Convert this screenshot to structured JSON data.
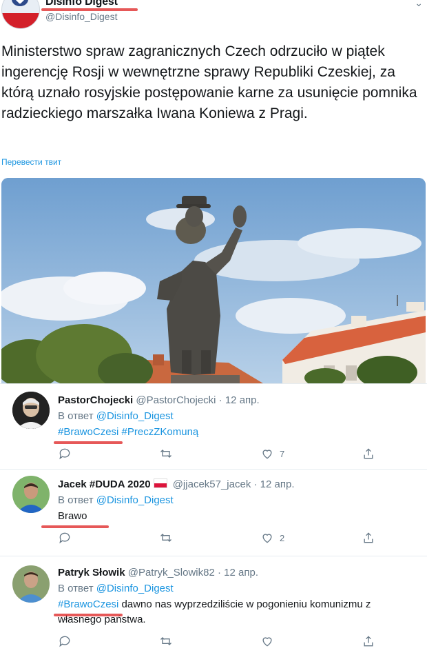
{
  "author": {
    "name": "Disinfo Digest",
    "handle": "@Disinfo_Digest"
  },
  "tweet": {
    "text": "Ministerstwo spraw zagranicznych Czech odrzuciło w piątek ingerencję Rosji w wewnętrzne sprawy Republiki Czeskiej, za którą uznało rosyjskie postępowanie karne za usunięcie pomnika radzieckiego marszałka Iwana Koniewa z Pragi.",
    "translate_label": "Перевести твит"
  },
  "replies": [
    {
      "name": "PastorChojecki",
      "handle": "@PastorChojecki",
      "separator": " · ",
      "date": "12 апр.",
      "reply_prefix": "В ответ ",
      "reply_to": "@Disinfo_Digest",
      "hashtags": [
        "#BrawoCzesi",
        "#PreczZKomuną"
      ],
      "likes": "7"
    },
    {
      "name": "Jacek #DUDA 2020",
      "handle": "@jjacek57_jacek",
      "separator": " · ",
      "date": "12 апр.",
      "reply_prefix": "В ответ ",
      "reply_to": "@Disinfo_Digest",
      "text": "Brawo",
      "likes": "2"
    },
    {
      "name": "Patryk Słowik",
      "handle": "@Patryk_Slowik82",
      "separator": " · ",
      "date": "12 апр.",
      "reply_prefix": "В ответ ",
      "reply_to": "@Disinfo_Digest",
      "hashtag": "#BrawoCzesi",
      "text": " dawno nas wyprzedziliście w pogonieniu komunizmu z własnego państwa."
    }
  ],
  "colors": {
    "link": "#1b95e0",
    "highlight_underline": "#e23b3b",
    "secondary_text": "#657786"
  }
}
